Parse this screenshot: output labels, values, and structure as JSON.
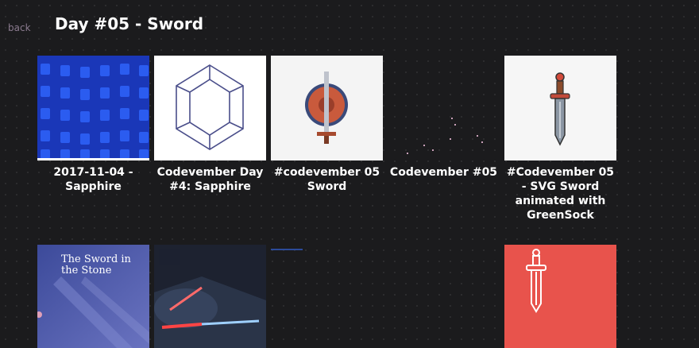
{
  "header": {
    "back_label": "back",
    "title": "Day #05 - Sword"
  },
  "grid": {
    "row1": [
      {
        "caption": "2017-11-04 - Sapphire",
        "thumb_icon": "blue-cubes-pattern-icon"
      },
      {
        "caption": "Codevember Day #4: Sapphire",
        "thumb_icon": "sapphire-gem-icon"
      },
      {
        "caption": "#codevember 05 Sword",
        "thumb_icon": "sword-shield-icon"
      },
      {
        "caption": "Codevember #05",
        "thumb_icon": "dark-particles-icon"
      },
      {
        "caption": "#Codevember 05 - SVG Sword animated with GreenSock",
        "thumb_icon": "svg-sword-icon"
      }
    ],
    "row2": [
      {
        "thumb_icon": "sword-in-the-stone-poster-icon",
        "thumb_text": "The Sword in the Stone"
      },
      {
        "thumb_icon": "lightsaber-scene-icon"
      },
      {
        "thumb_icon": "blank-dark-icon"
      },
      {
        "thumb_icon": "blank-dark-icon"
      },
      {
        "thumb_icon": "sword-red-background-icon"
      }
    ]
  },
  "colors": {
    "background": "#1b1b1d",
    "blue_thumb": "#1d3fc9",
    "red_thumb": "#e8534c",
    "text": "#ffffff",
    "back_link": "#8a7a8e"
  }
}
